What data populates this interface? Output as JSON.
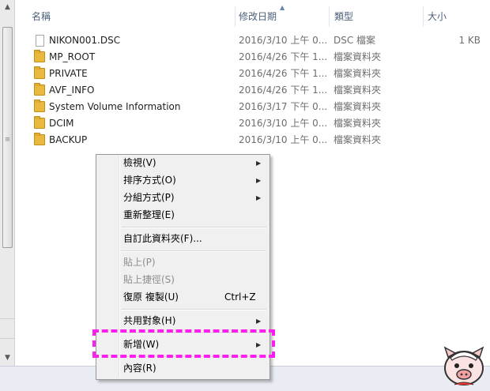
{
  "header": {
    "col_name": "名稱",
    "col_date": "修改日期",
    "col_type": "類型",
    "col_size": "大小"
  },
  "files": [
    {
      "icon": "document-icon",
      "name": "NIKON001.DSC",
      "date": "2016/3/10 上午 0...",
      "type": "DSC 檔案",
      "size": "1 KB"
    },
    {
      "icon": "folder-icon",
      "name": "MP_ROOT",
      "date": "2016/4/26 下午 1...",
      "type": "檔案資料夾",
      "size": ""
    },
    {
      "icon": "folder-icon",
      "name": "PRIVATE",
      "date": "2016/4/26 下午 1...",
      "type": "檔案資料夾",
      "size": ""
    },
    {
      "icon": "folder-icon",
      "name": "AVF_INFO",
      "date": "2016/4/26 下午 1...",
      "type": "檔案資料夾",
      "size": ""
    },
    {
      "icon": "folder-icon",
      "name": "System Volume Information",
      "date": "2016/3/17 下午 0...",
      "type": "檔案資料夾",
      "size": ""
    },
    {
      "icon": "folder-icon",
      "name": "DCIM",
      "date": "2016/3/10 上午 0...",
      "type": "檔案資料夾",
      "size": ""
    },
    {
      "icon": "folder-icon",
      "name": "BACKUP",
      "date": "2016/3/10 上午 0...",
      "type": "檔案資料夾",
      "size": ""
    }
  ],
  "context_menu": {
    "view": "檢視(V)",
    "sort_by": "排序方式(O)",
    "group_by": "分組方式(P)",
    "refresh": "重新整理(E)",
    "customize": "自訂此資料夾(F)...",
    "paste": "貼上(P)",
    "paste_shortcut": "貼上捷徑(S)",
    "undo_copy": "復原 複製(U)",
    "undo_shortcut": "Ctrl+Z",
    "share_with": "共用對象(H)",
    "new": "新增(W)",
    "properties": "內容(R)"
  },
  "colors": {
    "highlight": "#ff1ef0",
    "folder": "#e8b93c",
    "header_text": "#4c607a"
  }
}
